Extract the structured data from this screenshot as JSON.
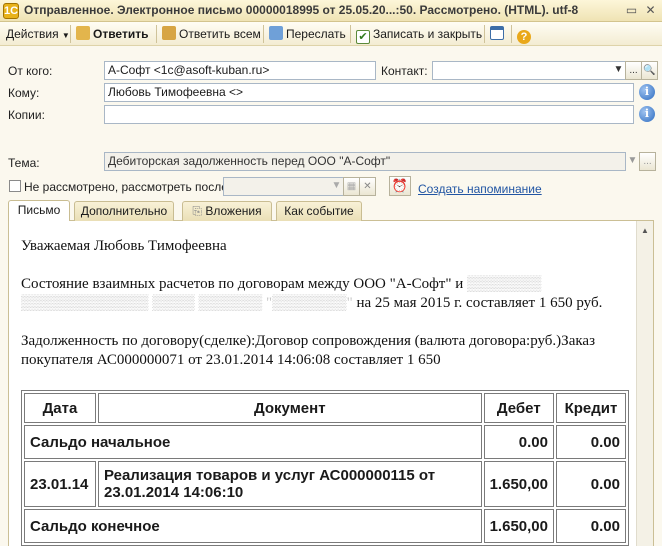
{
  "window": {
    "title": "Отправленное. Электронное письмо 00000018995 от 25.05.20...:50. Рассмотрено. (HTML). utf-8",
    "app_icon": "1C"
  },
  "toolbar": {
    "actions_label": "Действия",
    "reply_label": "Ответить",
    "reply_all_label": "Ответить всем",
    "forward_label": "Переслать",
    "save_close_label": "Записать и закрыть"
  },
  "form": {
    "from_label": "От кого:",
    "from_value": "А-Софт <1c@asoft-kuban.ru>",
    "contact_label": "Контакт:",
    "contact_value": "",
    "to_label": "Кому:",
    "to_value": "Любовь Тимофеевна <>",
    "cc_label": "Копии:",
    "cc_value": "",
    "subject_label": "Тема:",
    "subject_value": "Дебиторская задолженность перед  ООО \"А-Софт\"",
    "not_reviewed_label": "Не рассмотрено, рассмотреть после:",
    "review_date_value": "",
    "reminder_link": "Создать напоминание"
  },
  "tabs": [
    {
      "label": "Письмо"
    },
    {
      "label": "Дополнительно"
    },
    {
      "label": "Вложения"
    },
    {
      "label": "Как событие"
    }
  ],
  "letter": {
    "greeting": "Уважаемая Любовь Тимофеевна",
    "p1": "Состояние взаимных расчетов по договорам между ООО \"А-Софт\" и ",
    "p1_tail": " на 25 мая 2015 г. составляет 1 650 руб.",
    "p2": "Задолженность по договору(сделке):Договор сопровождения (валюта договора:руб.)Заказ покупателя АС000000071 от 23.01.2014 14:06:08 составляет 1 650"
  },
  "table": {
    "headers": [
      "Дата",
      "Документ",
      "Дебет",
      "Кредит"
    ],
    "rows": [
      {
        "date": "Сальдо начальное",
        "doc": "",
        "debit": "0.00",
        "credit": "0.00"
      },
      {
        "date": "23.01.14",
        "doc": "Реализация товаров и услуг АС000000115 от 23.01.2014 14:06:10",
        "debit": "1.650,00",
        "credit": "0.00"
      },
      {
        "date": "Сальдо конечное",
        "doc": "",
        "debit": "1.650,00",
        "credit": "0.00"
      }
    ]
  },
  "colors": {
    "accent_link": "#2155a3",
    "window_bg": "#fbf8ee"
  }
}
